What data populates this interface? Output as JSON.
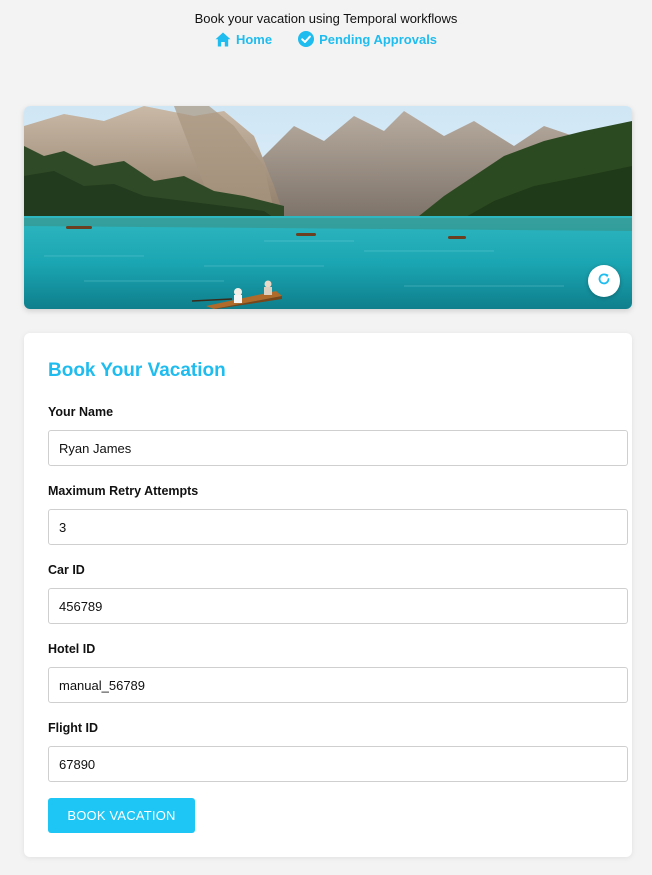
{
  "header": {
    "tagline": "Book your vacation using Temporal workflows",
    "nav": [
      {
        "label": "Home",
        "icon": "home-icon"
      },
      {
        "label": "Pending Approvals",
        "icon": "check-circle-icon"
      }
    ]
  },
  "hero": {
    "image": "mountain-lake-photo",
    "refresh_icon": "refresh-icon"
  },
  "form": {
    "title": "Book Your Vacation",
    "fields": [
      {
        "label": "Your Name",
        "value": "Ryan James"
      },
      {
        "label": "Maximum Retry Attempts",
        "value": "3"
      },
      {
        "label": "Car ID",
        "value": "456789"
      },
      {
        "label": "Hotel ID",
        "value": "manual_56789"
      },
      {
        "label": "Flight ID",
        "value": "67890"
      }
    ],
    "submit_label": "BOOK VACATION"
  },
  "colors": {
    "accent": "#1fbcef",
    "button": "#1ec6f6",
    "background": "#f3f3f3"
  }
}
